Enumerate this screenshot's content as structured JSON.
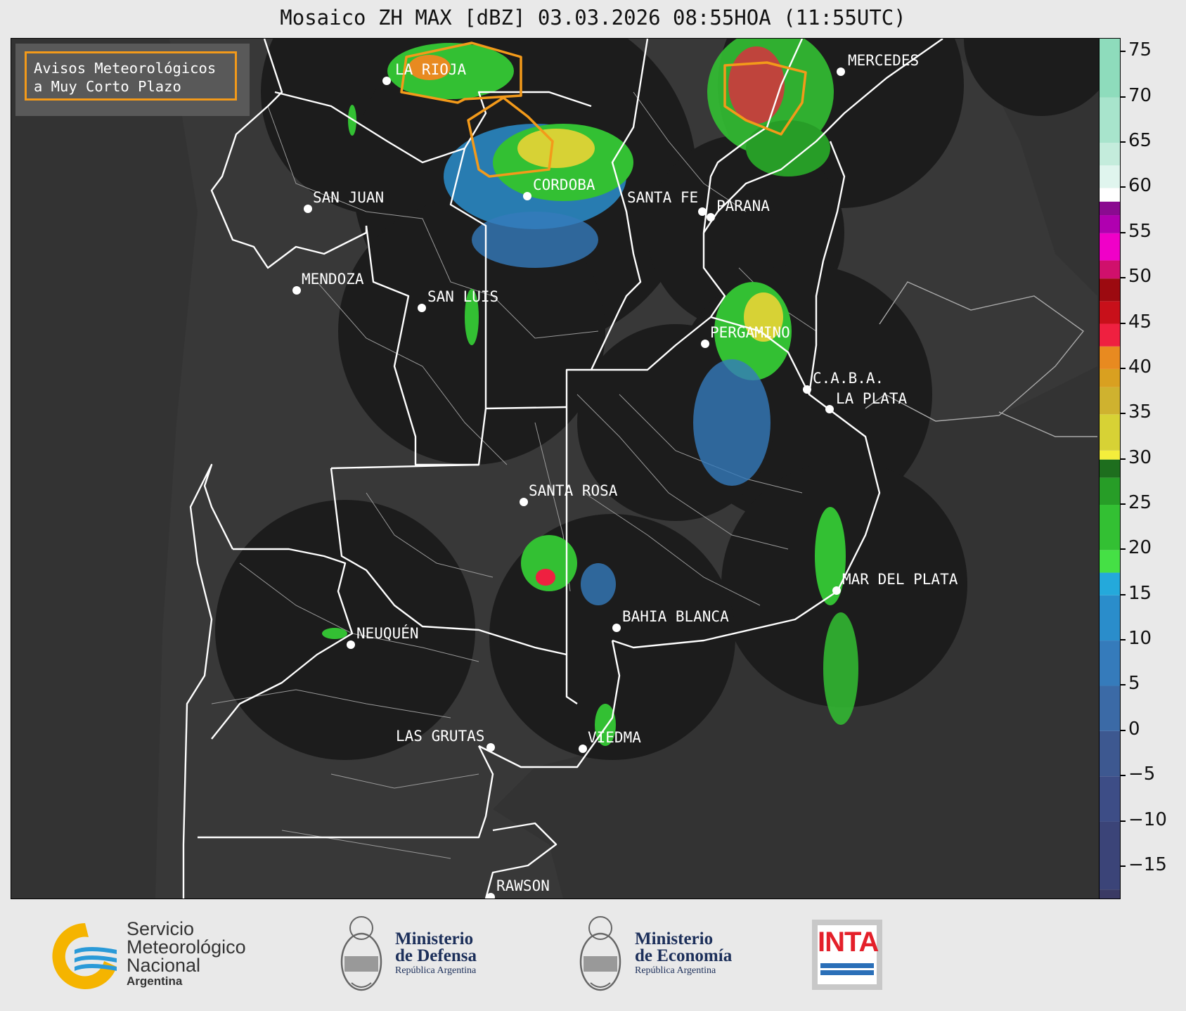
{
  "title": "Mosaico ZH MAX [dBZ] 03.03.2026 08:55HOA (11:55UTC)",
  "legend": {
    "line1": "Avisos Meteorológicos",
    "line2": "a Muy Corto Plazo",
    "border_color": "#f39a1a"
  },
  "cities": [
    {
      "name": "LA RIOJA",
      "dot": [
        549,
        114
      ],
      "label": [
        561,
        105
      ]
    },
    {
      "name": "MERCEDES",
      "dot": [
        1195,
        101
      ],
      "label": [
        1205,
        92
      ]
    },
    {
      "name": "CORDOBA",
      "dot": [
        749,
        278
      ],
      "label": [
        757,
        269
      ]
    },
    {
      "name": "SAN JUAN",
      "dot": [
        437,
        296
      ],
      "label": [
        444,
        287
      ]
    },
    {
      "name": "SANTA FE",
      "dot": [
        998,
        300
      ],
      "label": [
        891,
        287
      ]
    },
    {
      "name": "PARANA",
      "dot": [
        1010,
        308
      ],
      "label": [
        1018,
        299
      ]
    },
    {
      "name": "MENDOZA",
      "dot": [
        421,
        412
      ],
      "label": [
        428,
        403
      ]
    },
    {
      "name": "SAN LUIS",
      "dot": [
        599,
        437
      ],
      "label": [
        607,
        428
      ]
    },
    {
      "name": "PERGAMINO",
      "dot": [
        1002,
        488
      ],
      "label": [
        1009,
        479
      ]
    },
    {
      "name": "C.A.B.A.",
      "dot": [
        1147,
        553
      ],
      "label": [
        1155,
        544
      ]
    },
    {
      "name": "LA PLATA",
      "dot": [
        1179,
        581
      ],
      "label": [
        1188,
        573
      ]
    },
    {
      "name": "SANTA ROSA",
      "dot": [
        744,
        713
      ],
      "label": [
        751,
        704
      ]
    },
    {
      "name": "MAR DEL PLATA",
      "dot": [
        1189,
        839
      ],
      "label": [
        1197,
        830
      ]
    },
    {
      "name": "BAHIA BLANCA",
      "dot": [
        876,
        892
      ],
      "label": [
        884,
        883
      ]
    },
    {
      "name": "NEUQUÉN",
      "dot": [
        498,
        916
      ],
      "label": [
        506,
        907
      ]
    },
    {
      "name": "LAS GRUTAS",
      "dot": [
        697,
        1062
      ],
      "label": [
        562,
        1053
      ]
    },
    {
      "name": "VIEDMA",
      "dot": [
        828,
        1064
      ],
      "label": [
        835,
        1055
      ]
    },
    {
      "name": "RAWSON",
      "dot": [
        697,
        1275
      ],
      "label": [
        705,
        1266
      ]
    }
  ],
  "colorbar": {
    "unit": "dBZ",
    "ticks": [
      "75",
      "70",
      "65",
      "60",
      "55",
      "50",
      "45",
      "40",
      "35",
      "30",
      "25",
      "20",
      "15",
      "10",
      "5",
      "0",
      "−5",
      "−10",
      "−15"
    ],
    "tick_values": [
      75,
      70,
      65,
      60,
      55,
      50,
      45,
      40,
      35,
      30,
      25,
      20,
      15,
      10,
      5,
      0,
      -5,
      -10,
      -15
    ],
    "range": [
      -18.5,
      76.5
    ],
    "bands": [
      {
        "from": -18.5,
        "to": -17.5,
        "color": "#3a3a64"
      },
      {
        "from": -17.5,
        "to": -10,
        "color": "#3b4478"
      },
      {
        "from": -10,
        "to": -5,
        "color": "#3d4d86"
      },
      {
        "from": -5,
        "to": 0,
        "color": "#3d5890"
      },
      {
        "from": 0,
        "to": 5,
        "color": "#3b6aa6"
      },
      {
        "from": 5,
        "to": 10,
        "color": "#357bbb"
      },
      {
        "from": 10,
        "to": 15,
        "color": "#2a8dcb"
      },
      {
        "from": 15,
        "to": 17.5,
        "color": "#24a9db"
      },
      {
        "from": 17.5,
        "to": 20,
        "color": "#45e045"
      },
      {
        "from": 20,
        "to": 25,
        "color": "#33c033"
      },
      {
        "from": 25,
        "to": 28,
        "color": "#279d27"
      },
      {
        "from": 28,
        "to": 30,
        "color": "#1e6e1e"
      },
      {
        "from": 30,
        "to": 31,
        "color": "#f4ee3c"
      },
      {
        "from": 31,
        "to": 35,
        "color": "#d7d235"
      },
      {
        "from": 35,
        "to": 38,
        "color": "#cfb22f"
      },
      {
        "from": 38,
        "to": 40,
        "color": "#d9a020"
      },
      {
        "from": 40,
        "to": 42.5,
        "color": "#e88a20"
      },
      {
        "from": 42.5,
        "to": 45,
        "color": "#ef2040"
      },
      {
        "from": 45,
        "to": 47.5,
        "color": "#c8101a"
      },
      {
        "from": 47.5,
        "to": 50,
        "color": "#9c0a10"
      },
      {
        "from": 50,
        "to": 52,
        "color": "#d0106c"
      },
      {
        "from": 52,
        "to": 55,
        "color": "#f000c8"
      },
      {
        "from": 55,
        "to": 57,
        "color": "#b000b0"
      },
      {
        "from": 57,
        "to": 58.5,
        "color": "#8a0a90"
      },
      {
        "from": 58.5,
        "to": 60,
        "color": "#ffffff"
      },
      {
        "from": 60,
        "to": 62.5,
        "color": "#e0f5ee"
      },
      {
        "from": 62.5,
        "to": 65,
        "color": "#c4ecdc"
      },
      {
        "from": 65,
        "to": 70,
        "color": "#a8e4cc"
      },
      {
        "from": 70,
        "to": 76.5,
        "color": "#8edcbc"
      }
    ]
  },
  "logos": {
    "smn": {
      "line1": "Servicio",
      "line2": "Meteorológico",
      "line3": "Nacional",
      "line4": "Argentina"
    },
    "defensa": {
      "line1": "Ministerio",
      "line2": "de Defensa",
      "line3": "República Argentina"
    },
    "economia": {
      "line1": "Ministerio",
      "line2": "de Economía",
      "line3": "República Argentina"
    },
    "inta": {
      "text": "INTA"
    }
  }
}
